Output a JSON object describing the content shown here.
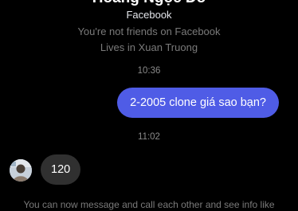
{
  "profile": {
    "name": "Hoàng Ngọc Đô",
    "source": "Facebook",
    "friend_status": "You're not friends on Facebook",
    "location": "Lives in Xuan Truong"
  },
  "messages": [
    {
      "type": "timestamp",
      "text": "10:36"
    },
    {
      "type": "outgoing",
      "text": "2-2005 clone giá sao bạn?"
    },
    {
      "type": "timestamp",
      "text": "11:02"
    },
    {
      "type": "incoming",
      "text": "120"
    }
  ],
  "footer": {
    "text": "You can now message and call each other and see info like"
  },
  "colors": {
    "background": "#000000",
    "outgoing_bubble": "#4f5ce6",
    "incoming_bubble": "#303030",
    "muted_text": "#7a7a7a"
  }
}
